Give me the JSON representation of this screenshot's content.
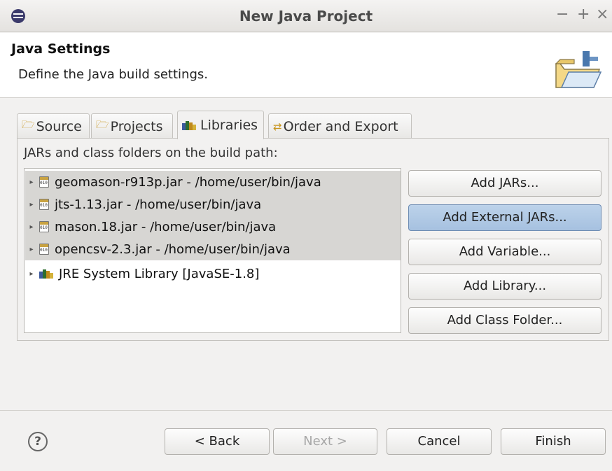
{
  "window": {
    "title": "New Java Project",
    "controls": [
      "−",
      "+",
      "×"
    ]
  },
  "header": {
    "title": "Java Settings",
    "description": "Define the Java build settings."
  },
  "tabs": [
    {
      "label": "Source",
      "icon": "source-folder-icon"
    },
    {
      "label": "Projects",
      "icon": "projects-folder-icon"
    },
    {
      "label": "Libraries",
      "icon": "libraries-icon",
      "active": true
    },
    {
      "label": "Order and Export",
      "icon": "order-export-icon"
    }
  ],
  "libraries": {
    "label": "JARs and class folders on the build path:",
    "items": [
      {
        "label": "geomason-r913p.jar - /home/user/bin/java",
        "icon": "jar-icon",
        "selected": true
      },
      {
        "label": "jts-1.13.jar - /home/user/bin/java",
        "icon": "jar-icon",
        "selected": true
      },
      {
        "label": "mason.18.jar - /home/user/bin/java",
        "icon": "jar-icon",
        "selected": true
      },
      {
        "label": "opencsv-2.3.jar - /home/user/bin/java",
        "icon": "jar-icon",
        "selected": true
      },
      {
        "label": "JRE System Library [JavaSE-1.8]",
        "icon": "library-icon",
        "selected": false
      }
    ]
  },
  "side_buttons": {
    "add_jars": "Add JARs...",
    "add_external_jars": "Add External JARs...",
    "add_variable": "Add Variable...",
    "add_library": "Add Library...",
    "add_class_folder": "Add Class Folder..."
  },
  "footer": {
    "help": "?",
    "back": "< Back",
    "next": "Next >",
    "cancel": "Cancel",
    "finish": "Finish"
  },
  "colors": {
    "hover_button": "#a9c4e2",
    "selection": "#d7d6d3",
    "jar_accent": "#c9a342"
  }
}
